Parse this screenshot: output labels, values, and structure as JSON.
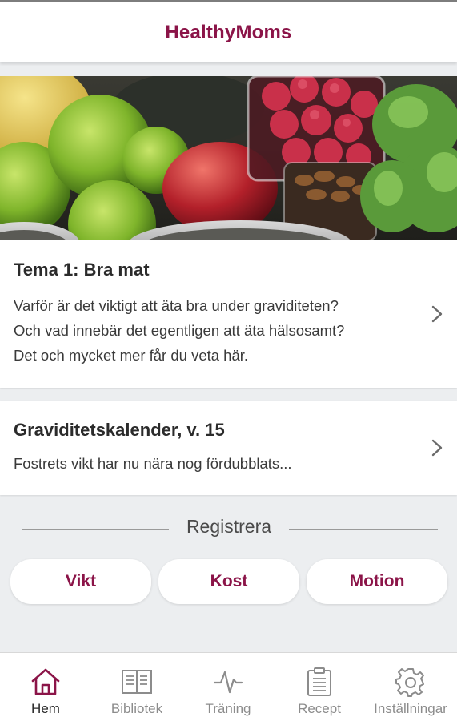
{
  "header": {
    "title": "HealthyMoms"
  },
  "hero": {
    "image_description_icon": "food-photo"
  },
  "theme_card": {
    "title": "Tema 1: Bra mat",
    "lines": [
      "Varför är det viktigt att äta bra under graviditeten?",
      "Och vad innebär det egentligen att äta hälsosamt?",
      "Det och mycket mer får du veta här."
    ]
  },
  "calendar_card": {
    "title": "Graviditetskalender, v. 15",
    "text": "Fostrets vikt har nu nära nog fördubblats..."
  },
  "register": {
    "label": "Registrera",
    "buttons": [
      "Vikt",
      "Kost",
      "Motion"
    ]
  },
  "bottom_nav": {
    "items": [
      {
        "label": "Hem",
        "icon": "home-icon",
        "active": true
      },
      {
        "label": "Bibliotek",
        "icon": "book-icon",
        "active": false
      },
      {
        "label": "Träning",
        "icon": "activity-icon",
        "active": false
      },
      {
        "label": "Recept",
        "icon": "clipboard-icon",
        "active": false
      },
      {
        "label": "Inställningar",
        "icon": "gear-icon",
        "active": false
      }
    ]
  },
  "colors": {
    "brand": "#8b1448",
    "background": "#eceef0",
    "inactive": "#8c8c8c"
  }
}
